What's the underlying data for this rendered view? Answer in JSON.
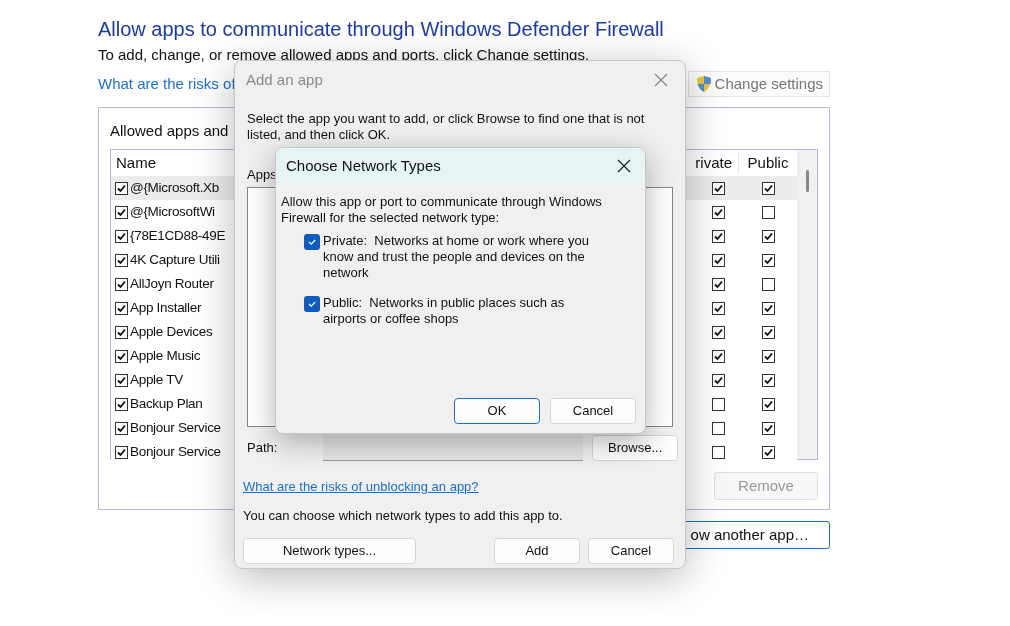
{
  "page": {
    "title": "Allow apps to communicate through Windows Defender Firewall",
    "subtitle": "To add, change, or remove allowed apps and ports, click Change settings.",
    "risks_link": "What are the risks of",
    "change_settings": "Change settings",
    "group_label": "Allowed apps and",
    "columns": [
      "Name",
      "rivate",
      "Public"
    ],
    "rows": [
      {
        "name": "@{Microsoft.Xb",
        "checked": true,
        "private": true,
        "public": true,
        "selected": true
      },
      {
        "name": "@{MicrosoftWi",
        "checked": true,
        "private": true,
        "public": false,
        "selected": false
      },
      {
        "name": "{78E1CD88-49E",
        "checked": true,
        "private": true,
        "public": true,
        "selected": false
      },
      {
        "name": "4K Capture Utili",
        "checked": true,
        "private": true,
        "public": true,
        "selected": false
      },
      {
        "name": "AllJoyn Router",
        "checked": true,
        "private": true,
        "public": false,
        "selected": false
      },
      {
        "name": "App Installer",
        "checked": true,
        "private": true,
        "public": true,
        "selected": false
      },
      {
        "name": "Apple Devices",
        "checked": true,
        "private": true,
        "public": true,
        "selected": false
      },
      {
        "name": "Apple Music",
        "checked": true,
        "private": true,
        "public": true,
        "selected": false
      },
      {
        "name": "Apple TV",
        "checked": true,
        "private": true,
        "public": true,
        "selected": false
      },
      {
        "name": "Backup Plan",
        "checked": true,
        "private": false,
        "public": true,
        "selected": false
      },
      {
        "name": "Bonjour Service",
        "checked": true,
        "private": false,
        "public": true,
        "selected": false
      },
      {
        "name": "Bonjour Service",
        "checked": true,
        "private": false,
        "public": true,
        "selected": false
      }
    ],
    "remove_button": {
      "label": "Remove",
      "disabled": true
    },
    "allow_another_button": "ow another app…"
  },
  "add_app_dialog": {
    "title": "Add an app",
    "instruction": "Select the app you want to add, or click Browse to find one that is not listed, and then click OK.",
    "apps_label": "Apps",
    "path_label": "Path:",
    "browse_button": "Browse...",
    "risks_link": "What are the risks of unblocking an app?",
    "note": "You can choose which network types to add this app to.",
    "network_types_button": "Network types...",
    "add_button": "Add",
    "cancel_button": "Cancel"
  },
  "network_dialog": {
    "title": "Choose Network Types",
    "intro": "Allow this app or port to communicate through Windows Firewall for the selected network type:",
    "options": [
      {
        "label": "Private:  Networks at home or work where you know and trust the people and devices on the network",
        "checked": true
      },
      {
        "label": "Public:  Networks in public places such as airports or coffee shops",
        "checked": true
      }
    ],
    "ok_button": "OK",
    "cancel_button": "Cancel"
  }
}
